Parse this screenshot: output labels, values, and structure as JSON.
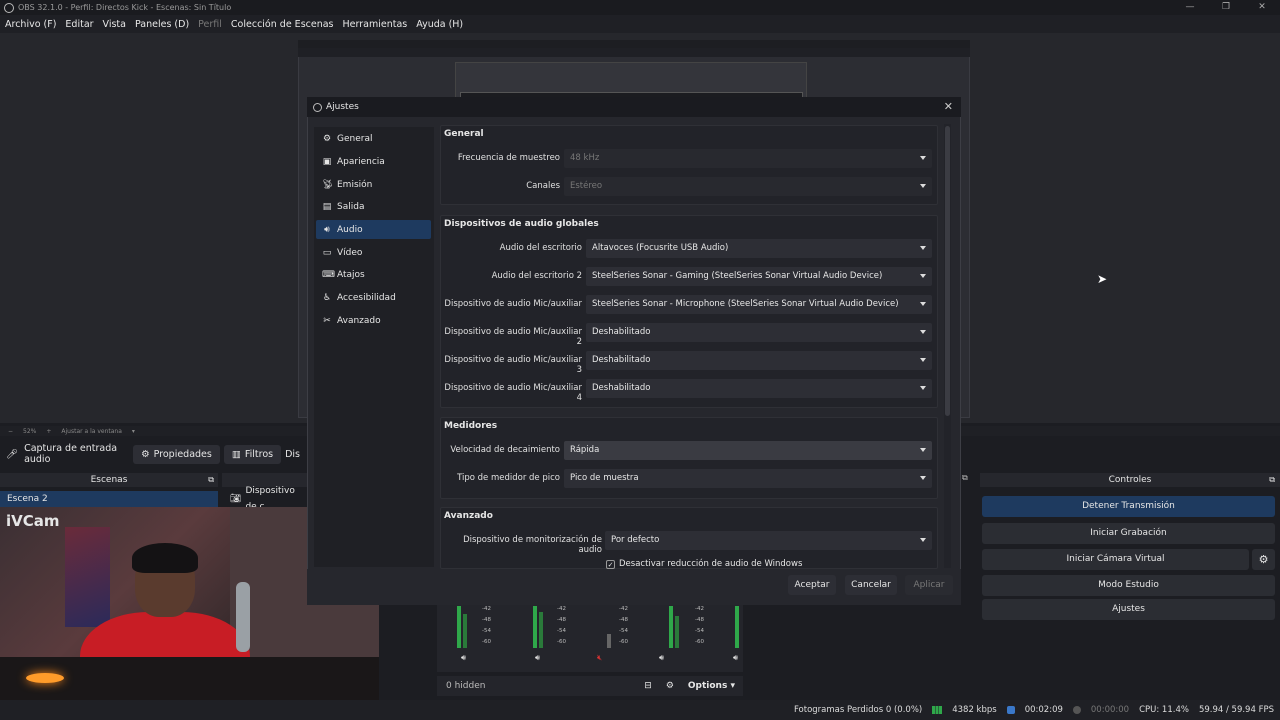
{
  "window": {
    "title": "OBS 32.1.0 - Perfil: Directos Kick - Escenas: Sin Título",
    "controls": [
      "—",
      "❐",
      "✕"
    ]
  },
  "menu": {
    "file": "Archivo (F)",
    "edit": "Editar",
    "view": "Vista",
    "docks": "Paneles (D)",
    "profile": "Perfil",
    "scene_collection": "Colección de Escenas",
    "tools": "Herramientas",
    "help": "Ayuda (H)"
  },
  "preview_bar": {
    "minus": "−",
    "zoom": "52%",
    "plus": "+",
    "fit": "Ajustar a la ventana"
  },
  "source_toolbar": {
    "source_name": "Captura de entrada audio",
    "properties": "Propiedades",
    "filters": "Filtros",
    "truncated": "Dis"
  },
  "scenes": {
    "header": "Escenas",
    "items": [
      "Escena 2"
    ]
  },
  "sources": {
    "items": [
      "Dispositivo de c"
    ]
  },
  "webcam": {
    "label": "iVCam"
  },
  "controls": {
    "header": "Controles",
    "stop_stream": "Detener Transmisión",
    "start_record": "Iniciar Grabación",
    "start_vcam": "Iniciar Cámara Virtual",
    "studio_mode": "Modo Estudio",
    "settings": "Ajustes"
  },
  "mixer": {
    "hidden": "0 hidden",
    "options": "Options",
    "scale": [
      "-42",
      "-48",
      "-54",
      "-60"
    ]
  },
  "status": {
    "dropped": "Fotogramas Perdidos 0 (0.0%)",
    "bitrate": "4382 kbps",
    "stream_time": "00:02:09",
    "rec_time": "00:00:00",
    "cpu": "CPU: 11.4%",
    "fps": "59.94 / 59.94 FPS"
  },
  "dialog": {
    "title": "Ajustes",
    "nav": [
      "General",
      "Apariencia",
      "Emisión",
      "Salida",
      "Audio",
      "Vídeo",
      "Atajos",
      "Accesibilidad",
      "Avanzado"
    ],
    "selected_nav": "Audio",
    "general": {
      "title": "General",
      "sample_rate_label": "Frecuencia de muestreo",
      "sample_rate": "48 kHz",
      "channels_label": "Canales",
      "channels": "Estéreo"
    },
    "global_audio": {
      "title": "Dispositivos de audio globales",
      "desktop_label": "Audio del escritorio",
      "desktop": "Altavoces (Focusrite USB Audio)",
      "desktop2_label": "Audio del escritorio 2",
      "desktop2": "SteelSeries Sonar - Gaming (SteelSeries Sonar Virtual Audio Device)",
      "mic_label": "Dispositivo de audio Mic/auxiliar",
      "mic": "SteelSeries Sonar - Microphone (SteelSeries Sonar Virtual Audio Device)",
      "mic2_label": "Dispositivo de audio Mic/auxiliar 2",
      "mic2": "Deshabilitado",
      "mic3_label": "Dispositivo de audio Mic/auxiliar 3",
      "mic3": "Deshabilitado",
      "mic4_label": "Dispositivo de audio Mic/auxiliar 4",
      "mic4": "Deshabilitado"
    },
    "meters": {
      "title": "Medidores",
      "decay_label": "Velocidad de decaimiento",
      "decay": "Rápida",
      "peak_label": "Tipo de medidor de pico",
      "peak": "Pico de muestra"
    },
    "advanced": {
      "title": "Avanzado",
      "monitor_label": "Dispositivo de monitorización de audio",
      "monitor": "Por defecto",
      "ducking_label": "Desactivar reducción de audio de Windows",
      "ducking_checked": true
    },
    "buttons": {
      "ok": "Aceptar",
      "cancel": "Cancelar",
      "apply": "Aplicar"
    }
  }
}
